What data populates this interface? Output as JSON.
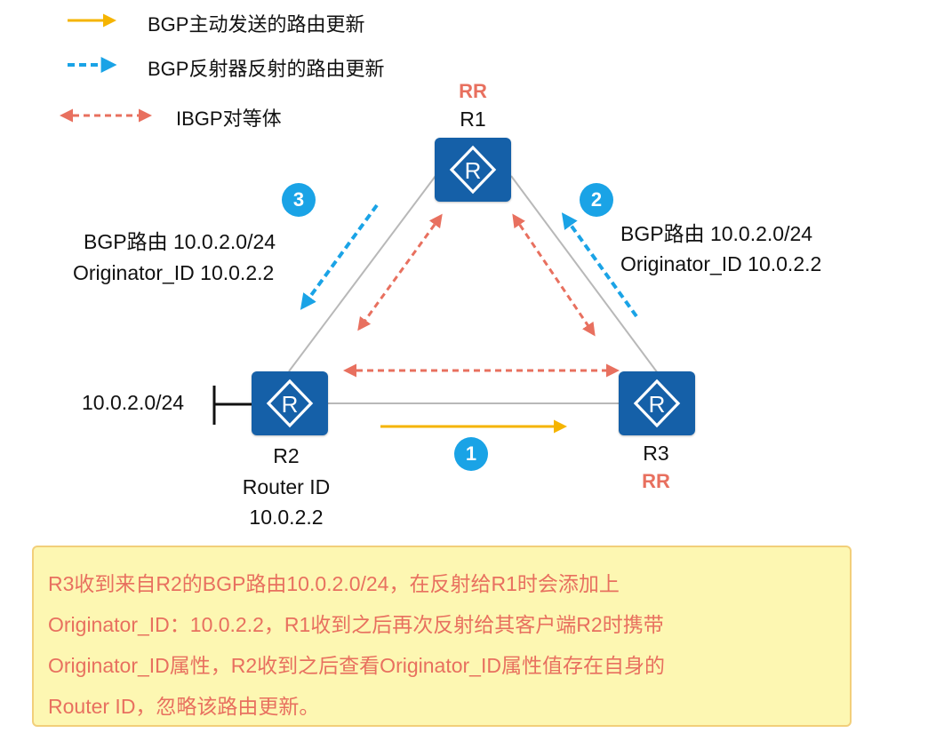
{
  "legend": [
    {
      "label": "BGP主动发送的路由更新",
      "style": "solid",
      "color": "#f5b400"
    },
    {
      "label": "BGP反射器反射的路由更新",
      "style": "dashed",
      "color": "#1aa3e6"
    },
    {
      "label": "IBGP对等体",
      "style": "dashed-double",
      "color": "#e8705f"
    }
  ],
  "routers": {
    "r1": {
      "name": "R1",
      "role": "RR"
    },
    "r2": {
      "name": "R2",
      "router_id_label": "Router ID",
      "router_id": "10.0.2.2"
    },
    "r3": {
      "name": "R3",
      "role": "RR"
    }
  },
  "network_label": "10.0.2.0/24",
  "steps": [
    "1",
    "2",
    "3"
  ],
  "route_info_right": {
    "line1": "BGP路由 10.0.2.0/24",
    "line2": "Originator_ID 10.0.2.2"
  },
  "route_info_left": {
    "line1": "BGP路由 10.0.2.0/24",
    "line2": "Originator_ID 10.0.2.2"
  },
  "note": {
    "lines": [
      "R3收到来自R2的BGP路由10.0.2.0/24，在反射给R1时会添加上",
      "Originator_ID：10.0.2.2，R1收到之后再次反射给其客户端R2时携带",
      "Originator_ID属性，R2收到之后查看Originator_ID属性值存在自身的",
      "Router ID，忽略该路由更新。"
    ]
  },
  "colors": {
    "router_blue": "#1560a8",
    "rr_red": "#e8705f",
    "update_yellow": "#f5b400",
    "reflect_blue": "#1aa3e6",
    "link_gray": "#b8b8b8",
    "note_bg": "#fdf7b2",
    "note_border": "#f2cf7a"
  }
}
